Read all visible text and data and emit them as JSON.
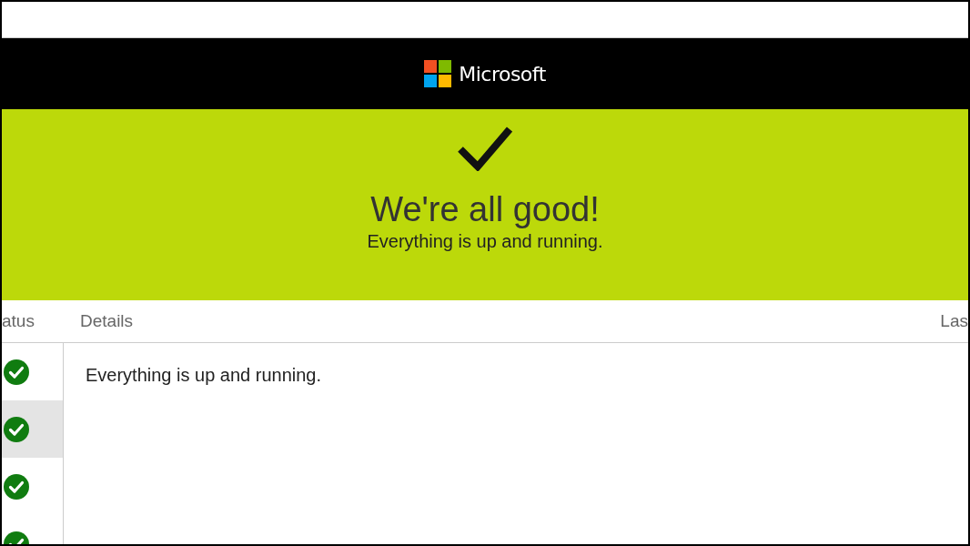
{
  "header": {
    "brand": "Microsoft"
  },
  "banner": {
    "title": "We're all good!",
    "subtitle": "Everything is up and running."
  },
  "table": {
    "columns": [
      "atus",
      "Details",
      "Las"
    ],
    "rows": [
      {
        "kind": "ok",
        "selected": false
      },
      {
        "kind": "ok",
        "selected": true
      },
      {
        "kind": "ok",
        "selected": false
      },
      {
        "kind": "ok",
        "selected": false
      }
    ],
    "details": "Everything is up and running."
  }
}
